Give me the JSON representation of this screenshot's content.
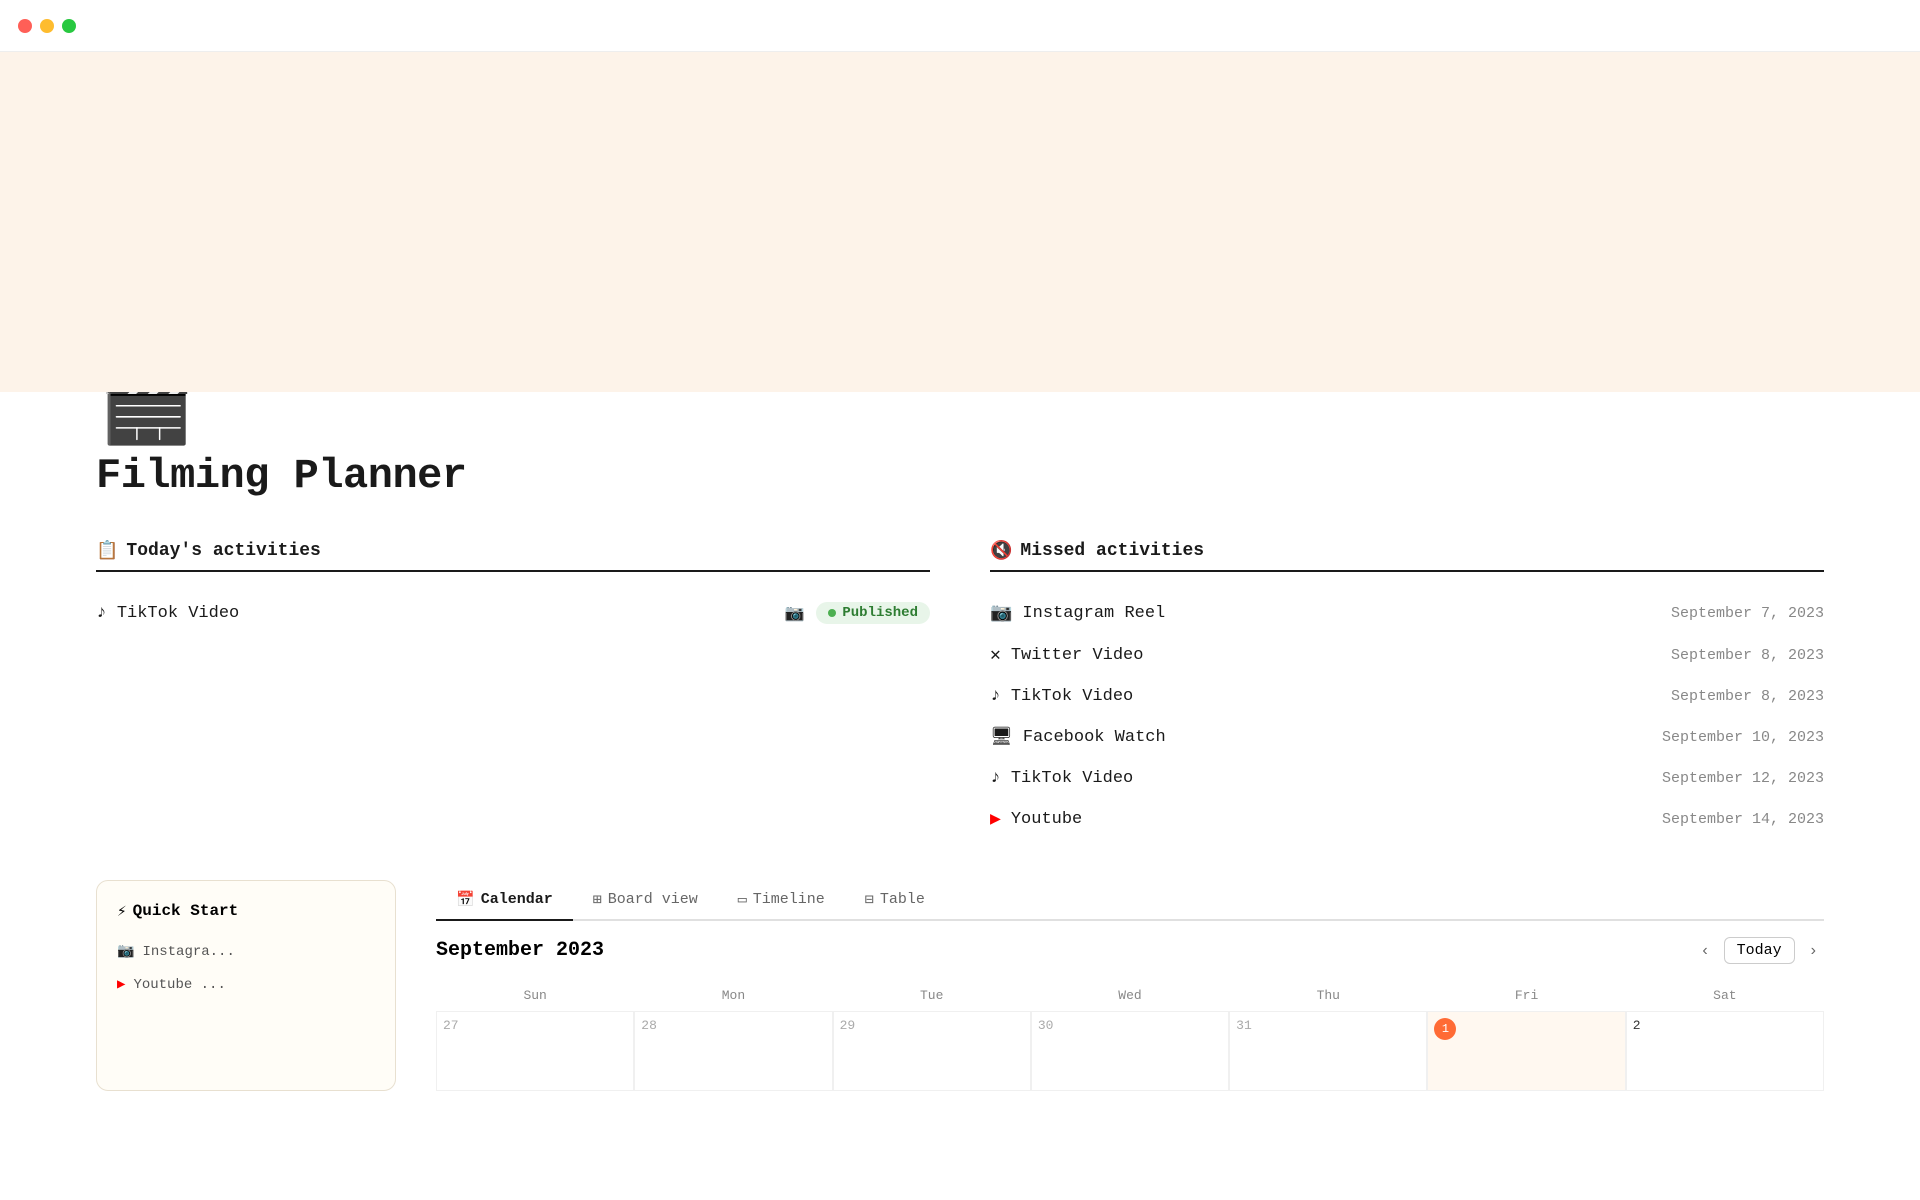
{
  "titlebar": {
    "traffic_lights": [
      "red",
      "yellow",
      "green"
    ]
  },
  "page": {
    "icon": "🎬",
    "title": "Filming Planner"
  },
  "today_activities": {
    "label": "Today's activities",
    "icon": "📋",
    "items": [
      {
        "platform": "TikTok Video",
        "platform_icon": "tiktok",
        "status": "Published",
        "status_type": "published"
      }
    ]
  },
  "missed_activities": {
    "label": "Missed activities",
    "icon": "🔇",
    "items": [
      {
        "platform": "Instagram Reel",
        "platform_icon": "instagram",
        "date": "September 7, 2023"
      },
      {
        "platform": "Twitter Video",
        "platform_icon": "twitter",
        "date": "September 8, 2023"
      },
      {
        "platform": "TikTok Video",
        "platform_icon": "tiktok",
        "date": "September 8, 2023"
      },
      {
        "platform": "Facebook Watch",
        "platform_icon": "facebook",
        "date": "September 10, 2023"
      },
      {
        "platform": "TikTok Video",
        "platform_icon": "tiktok",
        "date": "September 12, 2023"
      },
      {
        "platform": "Youtube",
        "platform_icon": "youtube",
        "date": "September 14, 2023"
      }
    ]
  },
  "quick_start": {
    "label": "Quick Start",
    "icon": "⚡",
    "items": [
      {
        "label": "Instagra...",
        "icon": "instagram"
      },
      {
        "label": "Youtube ...",
        "icon": "youtube"
      }
    ]
  },
  "calendar": {
    "tabs": [
      {
        "label": "Calendar",
        "icon": "📅",
        "active": true
      },
      {
        "label": "Board view",
        "icon": "⊞",
        "active": false
      },
      {
        "label": "Timeline",
        "icon": "▭",
        "active": false
      },
      {
        "label": "Table",
        "icon": "⊟",
        "active": false
      }
    ],
    "month_label": "September 2023",
    "nav": {
      "prev": "‹",
      "today": "Today",
      "next": "›"
    },
    "day_headers": [
      "Sun",
      "Mon",
      "Tue",
      "Wed",
      "Thu",
      "Fri",
      "Sat"
    ],
    "weeks": [
      [
        {
          "date": "27",
          "current": false
        },
        {
          "date": "28",
          "current": false
        },
        {
          "date": "29",
          "current": false
        },
        {
          "date": "30",
          "current": false
        },
        {
          "date": "31",
          "current": false
        },
        {
          "date": "Sep 1",
          "current": true,
          "today": true
        },
        {
          "date": "2",
          "current": true
        }
      ]
    ]
  }
}
